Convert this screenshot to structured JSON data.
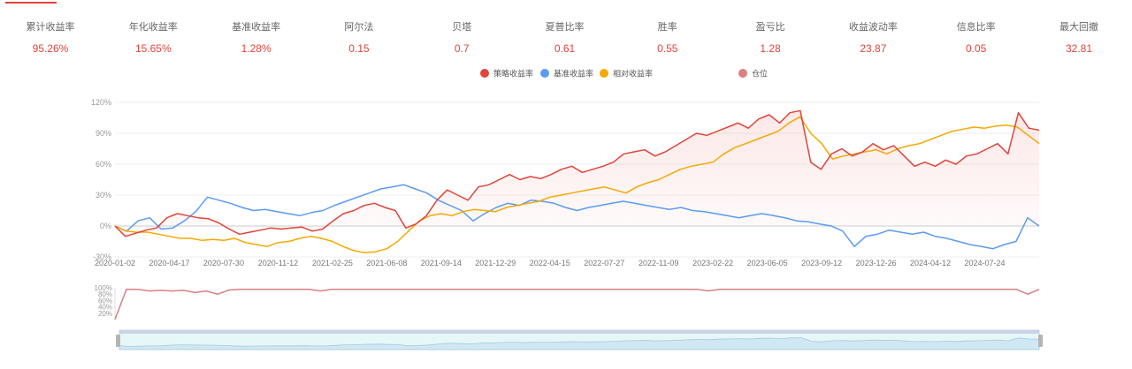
{
  "metrics": [
    {
      "label": "累计收益率",
      "value": "95.26%"
    },
    {
      "label": "年化收益率",
      "value": "15.65%"
    },
    {
      "label": "基准收益率",
      "value": "1.28%"
    },
    {
      "label": "阿尔法",
      "value": "0.15"
    },
    {
      "label": "贝塔",
      "value": "0.7"
    },
    {
      "label": "夏普比率",
      "value": "0.61"
    },
    {
      "label": "胜率",
      "value": "0.55"
    },
    {
      "label": "盈亏比",
      "value": "1.28"
    },
    {
      "label": "收益波动率",
      "value": "23.87"
    },
    {
      "label": "信息比率",
      "value": "0.05"
    },
    {
      "label": "最大回撤",
      "value": "32.81"
    }
  ],
  "legend": [
    {
      "label": "策略收益率",
      "color": "#e0443a"
    },
    {
      "label": "基准收益率",
      "color": "#5b9bf0"
    },
    {
      "label": "相对收益率",
      "color": "#f5a800"
    },
    {
      "label": "仓位",
      "color": "#d98080"
    }
  ],
  "chart_data": {
    "type": "line",
    "x_ticks": [
      "2020-01-02",
      "2020-04-17",
      "2020-07-30",
      "2020-11-12",
      "2021-02-25",
      "2021-06-08",
      "2021-09-14",
      "2021-12-29",
      "2022-04-15",
      "2022-07-27",
      "2022-11-09",
      "2023-02-22",
      "2023-06-05",
      "2023-09-12",
      "2023-12-26",
      "2024-04-12",
      "2024-07-24"
    ],
    "y_ticks": [
      "-30%",
      "0%",
      "30%",
      "60%",
      "90%",
      "120%"
    ],
    "ylim": [
      -30,
      120
    ],
    "series": [
      {
        "name": "策略收益率",
        "color": "#e0443a",
        "values": [
          0,
          -10,
          -7,
          -4,
          -2,
          8,
          12,
          10,
          8,
          7,
          3,
          -3,
          -8,
          -6,
          -4,
          -2,
          -3,
          -2,
          -1,
          -5,
          -3,
          5,
          12,
          15,
          20,
          22,
          18,
          15,
          -2,
          2,
          10,
          25,
          35,
          30,
          25,
          38,
          40,
          45,
          50,
          45,
          48,
          46,
          50,
          55,
          58,
          52,
          55,
          58,
          62,
          70,
          72,
          74,
          68,
          72,
          78,
          84,
          90,
          88,
          92,
          96,
          100,
          95,
          104,
          108,
          100,
          110,
          112,
          62,
          55,
          70,
          75,
          68,
          72,
          80,
          74,
          78,
          68,
          58,
          62,
          58,
          64,
          60,
          68,
          70,
          75,
          80,
          70,
          110,
          95,
          93
        ]
      },
      {
        "name": "基准收益率",
        "color": "#5b9bf0",
        "values": [
          0,
          -5,
          5,
          8,
          -3,
          -2,
          5,
          14,
          28,
          25,
          22,
          18,
          15,
          16,
          14,
          12,
          10,
          13,
          15,
          20,
          24,
          28,
          32,
          36,
          38,
          40,
          36,
          32,
          25,
          20,
          15,
          5,
          12,
          18,
          22,
          20,
          25,
          24,
          22,
          18,
          15,
          18,
          20,
          22,
          24,
          22,
          20,
          18,
          16,
          18,
          15,
          14,
          12,
          10,
          8,
          10,
          12,
          10,
          8,
          5,
          4,
          2,
          0,
          -5,
          -20,
          -10,
          -8,
          -4,
          -6,
          -8,
          -6,
          -10,
          -12,
          -15,
          -18,
          -20,
          -22,
          -18,
          -15,
          8,
          0
        ]
      },
      {
        "name": "相对收益率",
        "color": "#f5a800",
        "values": [
          0,
          -5,
          -6,
          -6,
          -8,
          -10,
          -12,
          -12,
          -14,
          -13,
          -14,
          -12,
          -16,
          -18,
          -20,
          -16,
          -15,
          -12,
          -10,
          -12,
          -15,
          -20,
          -24,
          -26,
          -25,
          -22,
          -15,
          -5,
          5,
          10,
          12,
          10,
          14,
          16,
          15,
          14,
          18,
          20,
          22,
          24,
          28,
          30,
          32,
          34,
          36,
          38,
          35,
          32,
          38,
          42,
          45,
          50,
          55,
          58,
          60,
          62,
          70,
          76,
          80,
          84,
          88,
          92,
          100,
          106,
          90,
          80,
          65,
          68,
          70,
          72,
          74,
          70,
          75,
          78,
          80,
          84,
          88,
          92,
          94,
          96,
          95,
          97,
          98,
          96,
          88,
          80
        ]
      },
      {
        "name": "仓位",
        "color": "#d98080",
        "values": [
          0,
          95,
          95,
          90,
          92,
          90,
          92,
          85,
          90,
          80,
          93,
          95,
          95,
          95,
          95,
          95,
          95,
          95,
          90,
          95,
          95,
          95,
          95,
          95,
          95,
          95,
          95,
          95,
          95,
          95,
          95,
          95,
          95,
          95,
          95,
          95,
          95,
          95,
          95,
          95,
          95,
          95,
          95,
          95,
          95,
          95,
          95,
          95,
          95,
          95,
          95,
          95,
          90,
          95,
          95,
          95,
          95,
          95,
          95,
          95,
          95,
          95,
          95,
          95,
          95,
          95,
          95,
          95,
          95,
          95,
          95,
          95,
          95,
          95,
          95,
          95,
          95,
          95,
          95,
          95,
          80,
          95
        ]
      }
    ],
    "position_y_ticks": [
      "100%",
      "80%",
      "60%",
      "40%",
      "20%"
    ],
    "position_ylim": [
      0,
      100
    ]
  }
}
